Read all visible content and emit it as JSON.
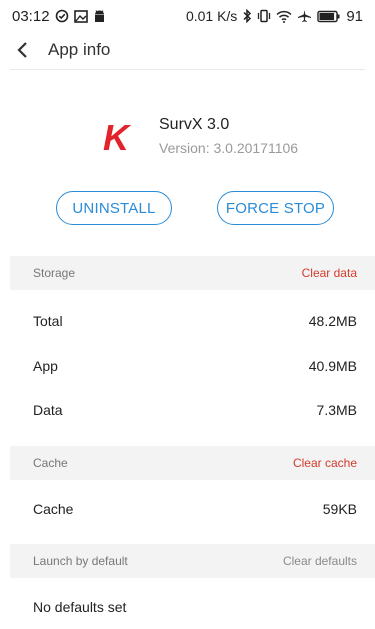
{
  "status_bar": {
    "time": "03:12",
    "left_icons": [
      "check-circle-icon",
      "gallery-icon",
      "android-icon"
    ],
    "network_speed": "0.01 K/s",
    "right_icons": [
      "bluetooth-icon",
      "vibrate-icon",
      "wifi-icon",
      "airplane-icon",
      "battery-icon"
    ],
    "battery": "91"
  },
  "app_bar": {
    "title": "App info",
    "back_icon": "chevron-left-icon"
  },
  "app": {
    "name": "SurvX 3.0",
    "version": "Version: 3.0.20171106",
    "logo_letter": "K",
    "logo_color": "#e3232b"
  },
  "buttons": {
    "uninstall": "UNINSTALL",
    "force_stop": "FORCE STOP",
    "color": "#2a8bd6"
  },
  "storage": {
    "title": "Storage",
    "action": "Clear data",
    "rows": [
      {
        "label": "Total",
        "value": "48.2MB"
      },
      {
        "label": "App",
        "value": "40.9MB"
      },
      {
        "label": "Data",
        "value": "7.3MB"
      }
    ]
  },
  "cache": {
    "title": "Cache",
    "action": "Clear cache",
    "rows": [
      {
        "label": "Cache",
        "value": "59KB"
      }
    ]
  },
  "launch": {
    "title": "Launch by default",
    "action": "Clear defaults",
    "rows": [
      {
        "label": "No defaults set"
      }
    ]
  }
}
